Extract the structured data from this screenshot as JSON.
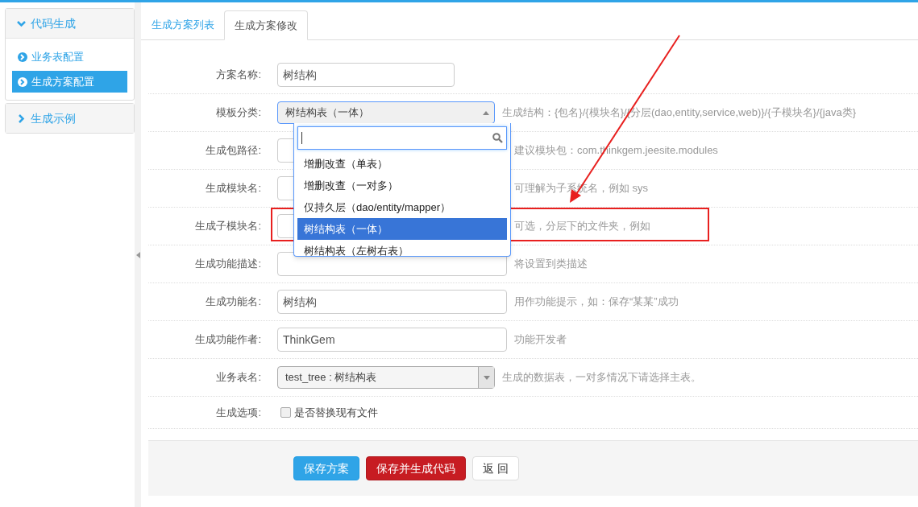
{
  "sidebar": [
    {
      "title": "代码生成",
      "expanded": true,
      "items": [
        {
          "label": "业务表配置",
          "selected": false
        },
        {
          "label": "生成方案配置",
          "selected": true
        }
      ]
    },
    {
      "title": "生成示例",
      "expanded": false
    }
  ],
  "tabs": [
    {
      "label": "生成方案列表",
      "selected": false
    },
    {
      "label": "生成方案修改",
      "selected": true
    }
  ],
  "form": {
    "rows": [
      {
        "label": "方案名称:",
        "kind": "short_input",
        "value": "树结构"
      },
      {
        "label": "模板分类:",
        "kind": "select",
        "value": "树结构表（一体）",
        "open": true,
        "help": "生成结构：{包名}/{模块名}/{分层(dao,entity,service,web)}/{子模块名}/{java类}"
      },
      {
        "label": "生成包路径:",
        "kind": "input",
        "help": "建议模块包：com.thinkgem.jeesite.modules"
      },
      {
        "label": "生成模块名:",
        "kind": "input",
        "help": "可理解为子系统名，例如 sys"
      },
      {
        "label": "生成子模块名:",
        "kind": "input",
        "help": "可选，分层下的文件夹，例如"
      },
      {
        "label": "生成功能描述:",
        "kind": "input",
        "help": "将设置到类描述"
      },
      {
        "label": "生成功能名:",
        "kind": "input",
        "value": "树结构",
        "help": "用作功能提示，如：保存“某某”成功"
      },
      {
        "label": "生成功能作者:",
        "kind": "input",
        "value": "ThinkGem",
        "help": "功能开发者"
      },
      {
        "label": "业务表名:",
        "kind": "select",
        "value": "test_tree : 树结构表",
        "open": false,
        "help": "生成的数据表，一对多情况下请选择主表。"
      },
      {
        "label": "生成选项:",
        "kind": "checkbox",
        "text": "是否替换现有文件",
        "checked": false
      }
    ]
  },
  "dropdown": {
    "options": [
      {
        "label": "增删改查（单表）",
        "selected": false
      },
      {
        "label": "增删改查（一对多）",
        "selected": false
      },
      {
        "label": "仅持久层（dao/entity/mapper）",
        "selected": false
      },
      {
        "label": "树结构表（一体）",
        "selected": true
      },
      {
        "label": "树结构表（左树右表）",
        "selected": false
      }
    ]
  },
  "buttons": [
    {
      "label": "保存方案",
      "kind": "primary"
    },
    {
      "label": "保存并生成代码",
      "kind": "danger"
    },
    {
      "label": "返 回",
      "kind": "default"
    }
  ]
}
